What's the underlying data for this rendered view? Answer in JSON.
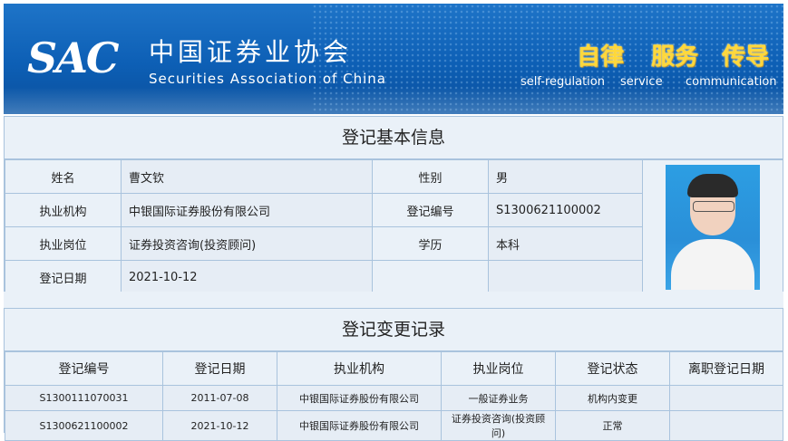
{
  "header": {
    "logo_text": "SAC",
    "org_name_cn": "中国证券业协会",
    "org_name_en": "Securities Association of China",
    "slogans": [
      {
        "cn": "自律",
        "en": "self-regulation"
      },
      {
        "cn": "服务",
        "en": "service"
      },
      {
        "cn": "传导",
        "en": "communication"
      }
    ]
  },
  "basic_info": {
    "title": "登记基本信息",
    "name_label": "姓名",
    "name_value": "曹文钦",
    "gender_label": "性别",
    "gender_value": "男",
    "org_label": "执业机构",
    "org_value": "中银国际证券股份有限公司",
    "reg_no_label": "登记编号",
    "reg_no_value": "S1300621100002",
    "position_label": "执业岗位",
    "position_value": "证券投资咨询(投资顾问)",
    "education_label": "学历",
    "education_value": "本科",
    "reg_date_label": "登记日期",
    "reg_date_value": "2021-10-12"
  },
  "change_records": {
    "title": "登记变更记录",
    "columns": [
      "登记编号",
      "登记日期",
      "执业机构",
      "执业岗位",
      "登记状态",
      "离职登记日期"
    ],
    "rows": [
      [
        "S1300111070031",
        "2011-07-08",
        "中银国际证券股份有限公司",
        "一般证券业务",
        "机构内变更",
        ""
      ],
      [
        "S1300621100002",
        "2021-10-12",
        "中银国际证券股份有限公司",
        "证券投资咨询(投资顾问)",
        "正常",
        ""
      ]
    ]
  }
}
